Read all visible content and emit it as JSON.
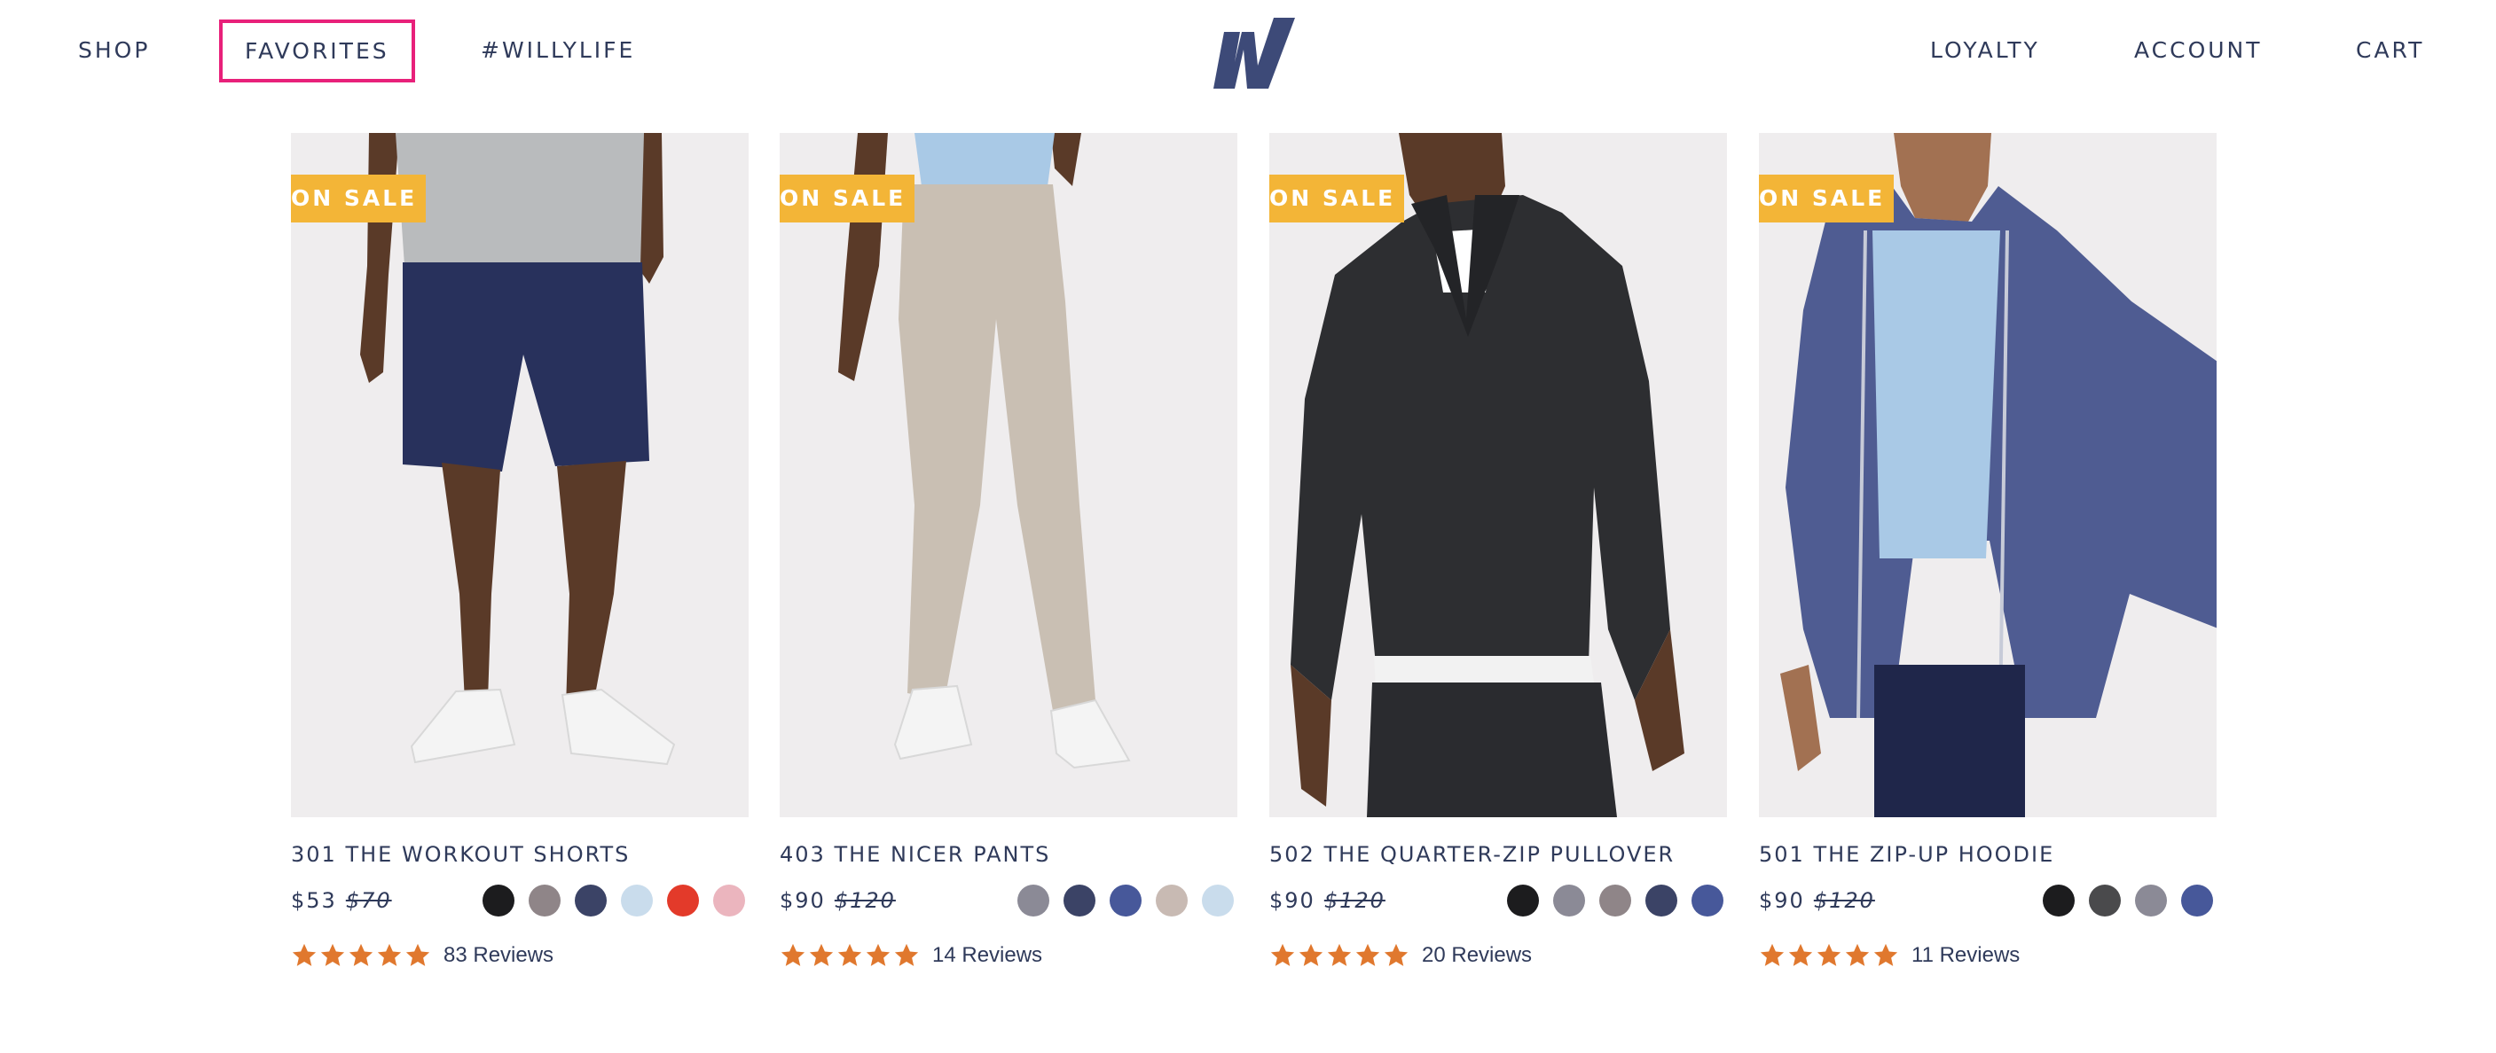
{
  "header": {
    "nav_left": [
      "SHOP",
      "FAVORITES",
      "#WILLYLIFE"
    ],
    "nav_right": [
      "LOYALTY",
      "ACCOUNT",
      "CART"
    ],
    "logo_icon": "willy-w-logo",
    "active_highlight_color": "#e8207a"
  },
  "colors": {
    "text": "#2f3a5a",
    "sale_badge": "#f3b537",
    "star": "#e0782e",
    "photo_background": "#efedee"
  },
  "products": [
    {
      "badge": "ON SALE",
      "name": "301 THE WORKOUT SHORTS",
      "price": "$53",
      "price_old": "$70",
      "swatches": [
        "#1c1c1e",
        "#8f8588",
        "#3b4366",
        "#c9dcec",
        "#e33a2a",
        "#ebb5be"
      ],
      "rating": 5,
      "reviews": "83 Reviews"
    },
    {
      "badge": "ON SALE",
      "name": "403 THE NICER PANTS",
      "price": "$90",
      "price_old": "$120",
      "swatches": [
        "#8b8a96",
        "#3b4366",
        "#47589a",
        "#c8bab3",
        "#c9dcec"
      ],
      "rating": 5,
      "reviews": "14 Reviews"
    },
    {
      "badge": "ON SALE",
      "name": "502 THE QUARTER-ZIP PULLOVER",
      "price": "$90",
      "price_old": "$120",
      "swatches": [
        "#1c1c1e",
        "#8b8a96",
        "#8f8588",
        "#3b4366",
        "#47589a"
      ],
      "rating": 5,
      "reviews": "20 Reviews"
    },
    {
      "badge": "ON SALE",
      "name": "501 THE ZIP-UP HOODIE",
      "price": "$90",
      "price_old": "$120",
      "swatches": [
        "#1c1c1e",
        "#4a4a4c",
        "#8b8a96",
        "#47589a"
      ],
      "rating": 5,
      "reviews": "11 Reviews"
    }
  ]
}
